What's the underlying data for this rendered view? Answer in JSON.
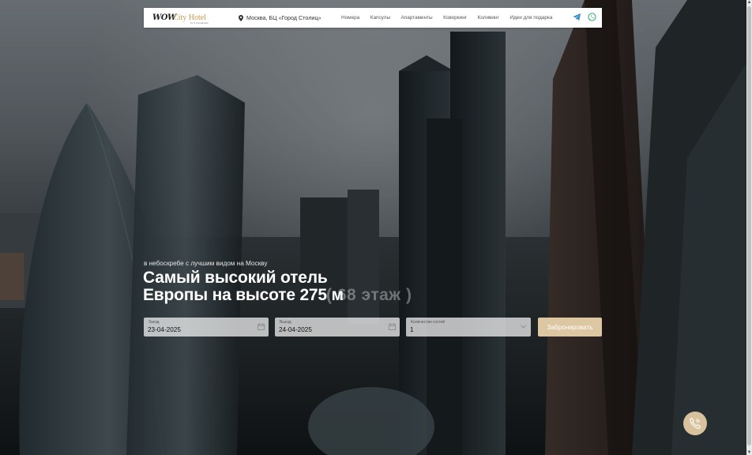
{
  "brand": {
    "logo_mark": "WOW",
    "logo_name": "City Hotel",
    "logo_sub": "by S.Constantine"
  },
  "header": {
    "address": "Москва, БЦ «Город Столиц»",
    "nav": [
      "Номера",
      "Капсулы",
      "Апартаменты",
      "Коворкинг",
      "Коливинг",
      "Идеи для подарка"
    ],
    "icons": [
      "telegram-icon",
      "whatsapp-icon"
    ]
  },
  "hero": {
    "tagline": "в небоскребе с лучшим видом на Москву",
    "headline_line1": "Самый высокий отель",
    "headline_line2": "Европы на высоте 275 м",
    "floor": "( 68 этаж )"
  },
  "booking": {
    "checkin_label": "Заезд",
    "checkin_value": "23-04-2025",
    "checkout_label": "Выезд",
    "checkout_value": "24-04-2025",
    "guests_label": "Количество гостей",
    "guests_value": "1",
    "submit_label": "Забронировать"
  },
  "colors": {
    "accent": "#dcc7a2",
    "logo_gold": "#c49a4e",
    "navbar_bg": "#ffffff"
  },
  "float": {
    "icon": "phone-icon"
  }
}
